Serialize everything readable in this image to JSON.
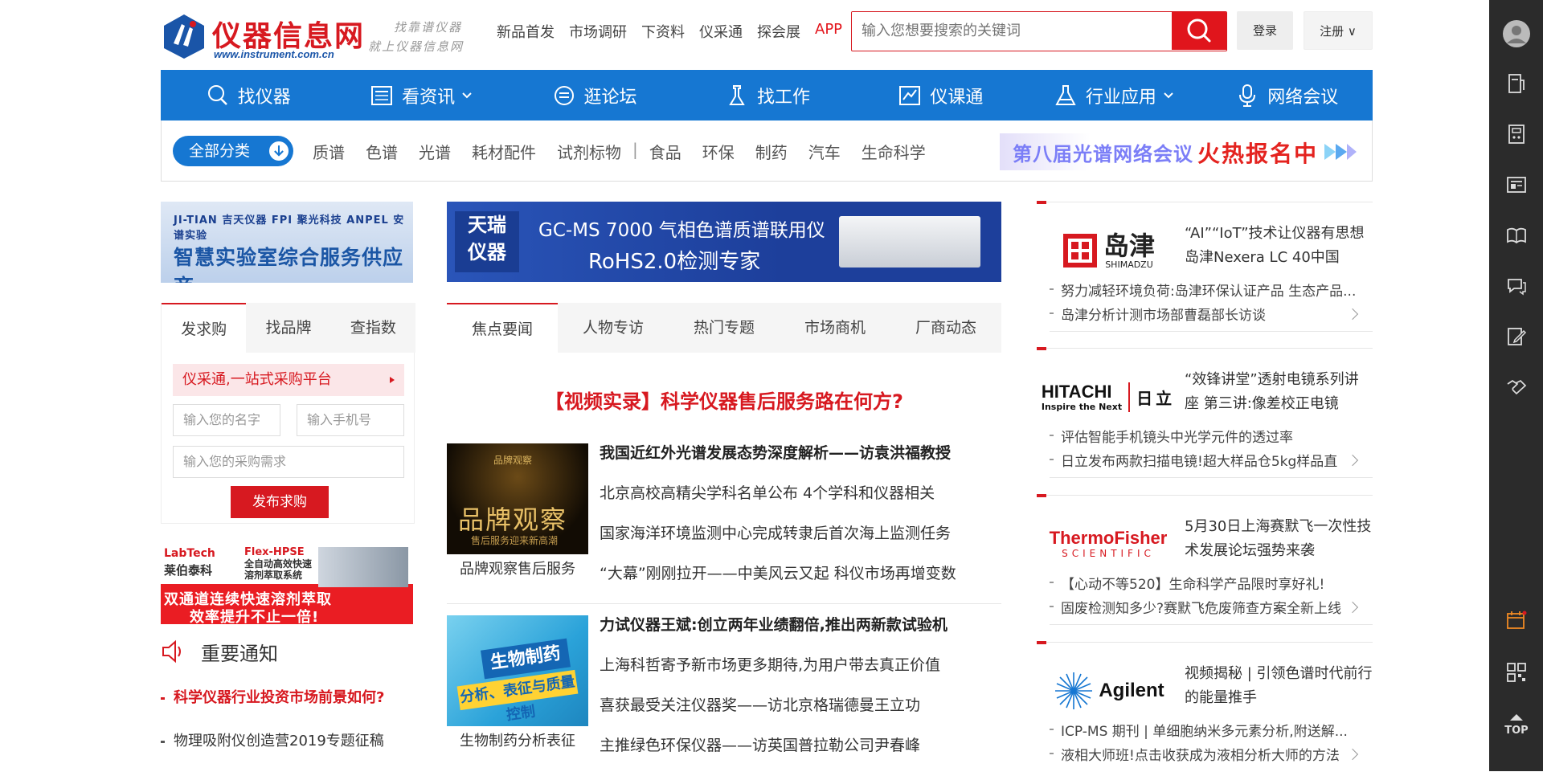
{
  "header": {
    "logo_name": "仪器信息网",
    "logo_url": "www.instrument.com.cn",
    "slogan_1": "找靠谱仪器",
    "slogan_2": "就上仪器信息网",
    "nav": [
      "新品首发",
      "市场调研",
      "下资料",
      "仪采通",
      "探会展",
      "APP"
    ],
    "search_placeholder": "输入您想要搜索的关键词",
    "login_label": "登录",
    "register_label": "注册 ∨"
  },
  "main_nav": [
    {
      "label": "找仪器",
      "icon": "search-icon"
    },
    {
      "label": "看资讯",
      "icon": "news-icon"
    },
    {
      "label": "逛论坛",
      "icon": "chat-icon"
    },
    {
      "label": "找工作",
      "icon": "job-icon"
    },
    {
      "label": "仪课通",
      "icon": "course-icon"
    },
    {
      "label": "行业应用",
      "icon": "flask-icon"
    },
    {
      "label": "网络会议",
      "icon": "microphone-icon"
    }
  ],
  "categories": {
    "all_label": "全部分类",
    "items": [
      "质谱",
      "色谱",
      "光谱",
      "耗材配件",
      "试剂标物",
      "|",
      "食品",
      "环保",
      "制药",
      "汽车",
      "生命科学"
    ],
    "banner_text_1": "第八届光谱网络会议",
    "banner_text_2": "火热报名中"
  },
  "left": {
    "ad_top_logos": "JI-TIAN 吉天仪器   FPI 聚光科技   ANPEL 安谱实验",
    "ad_top_text": "智慧实验室综合服务供应商",
    "tabs": [
      "发求购",
      "找品牌",
      "查指数"
    ],
    "promo": "仪采通,一站式采购平台",
    "name_placeholder": "输入您的名字",
    "phone_placeholder": "输入手机号",
    "need_placeholder": "输入您的采购需求",
    "submit_label": "发布求购",
    "ad2_brand": "LabTech",
    "ad2_brand_cn": "莱伯泰科",
    "ad2_prod_1": "Flex-HPSE",
    "ad2_prod_2": "全自动高效快速",
    "ad2_prod_3": "溶剂萃取系统",
    "ad2_line1": "双通道连续快速溶剂萃取",
    "ad2_line2": "效率提升不止一倍!",
    "notice_title": "重要通知",
    "notices": [
      "科学仪器行业投资市场前景如何?",
      "物理吸附仪创造营2019专题征稿"
    ]
  },
  "middle": {
    "ad_brand": "天瑞 仪器",
    "ad_line1": "GC-MS 7000 气相色谱质谱联用仪",
    "ad_line2": "RoHS2.0检测专家",
    "tabs": [
      "焦点要闻",
      "人物专访",
      "热门专题",
      "市场商机",
      "厂商动态"
    ],
    "headline": "【视频实录】科学仪器售后服务路在何方?",
    "blocks": [
      {
        "thumb_top": "品牌观察",
        "thumb_big": "品牌观察",
        "thumb_small": "售后服务迎来新高潮",
        "caption": "品牌观察售后服务",
        "items": [
          "我国近红外光谱发展态势深度解析——访袁洪福教授",
          "北京高校高精尖学科名单公布 4个学科和仪器相关",
          "国家海洋环境监测中心完成转隶后首次海上监测任务",
          "“大幕”刚刚拉开——中美风云又起 科仪市场再增变数"
        ]
      },
      {
        "thumb_big": "生物制药",
        "thumb_small": "分析、表征与质量控制",
        "caption": "生物制药分析表征",
        "items": [
          "力试仪器王斌:创立两年业绩翻倍,推出两新款试验机",
          "上海科哲寄予新市场更多期待,为用户带去真正价值",
          "喜获最受关注仪器奖——访北京格瑞德曼王立功",
          "主推绿色环保仪器——访英国普拉勒公司尹春峰"
        ]
      }
    ]
  },
  "right": {
    "brands": [
      {
        "logo": "岛津",
        "logo_sub": "SHIMADZU",
        "desc": "“AI”“IoT”技术让仪器有思想 岛津Nexera LC 40中国",
        "link1": "努力减轻环境负荷:岛津环保认证产品 生态产品...",
        "link2": "岛津分析计测市场部曹磊部长访谈"
      },
      {
        "logo": "HITACHI",
        "logo_sub": "Inspire the Next",
        "logo_cn": "日立",
        "desc": "“效锋讲堂”透射电镜系列讲座 第三讲:像差校正电镜",
        "link1": "评估智能手机镜头中光学元件的透过率",
        "link2": "日立发布两款扫描电镜!超大样品仓5kg样品直"
      },
      {
        "logo": "ThermoFisher",
        "logo_sub": "SCIENTIFIC",
        "desc": "5月30日上海赛默飞一次性技术发展论坛强势来袭",
        "link1": "【心动不等520】生命科学产品限时享好礼!",
        "link2": "固废检测知多少?赛默飞危废筛查方案全新上线"
      },
      {
        "logo": "Agilent",
        "desc": "视频揭秘 | 引领色谱时代前行的能量推手",
        "link1": "ICP-MS 期刊 | 单细胞纳米多元素分析,附送解...",
        "link2": "液相大师班!点击收获成为液相分析大师的方法"
      }
    ]
  },
  "sidebar": {
    "icons": [
      "user-avatar-icon",
      "instrument-icon",
      "calculator-icon",
      "news-icon",
      "book-icon",
      "chat-icon",
      "edit-icon",
      "handshake-icon",
      "calendar-icon",
      "qrcode-icon",
      "back-to-top-icon"
    ],
    "top_label": "TOP"
  }
}
